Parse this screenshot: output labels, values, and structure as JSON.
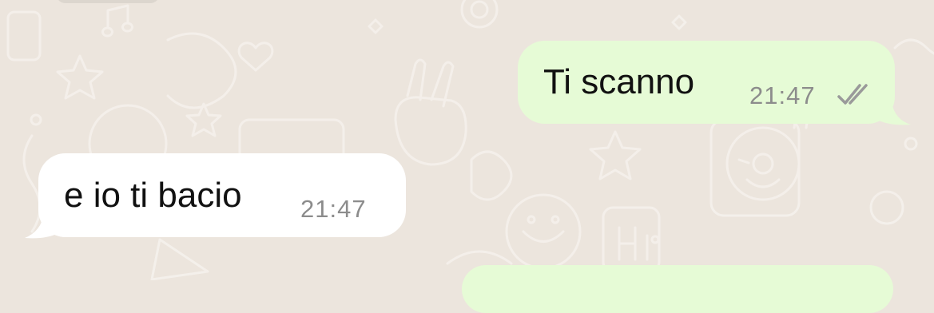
{
  "chat": {
    "messages": [
      {
        "direction": "outgoing",
        "text": "Ti scanno",
        "time": "21:47",
        "status": "read"
      },
      {
        "direction": "incoming",
        "text": "e io ti bacio",
        "time": "21:47"
      }
    ]
  },
  "colors": {
    "wallpaper": "#ece5dd",
    "outgoing_bubble": "#e6fbd6",
    "incoming_bubble": "#ffffff",
    "message_text": "#111111",
    "timestamp": "#8c8c8c"
  },
  "icons": {
    "status": "double-check-icon"
  }
}
